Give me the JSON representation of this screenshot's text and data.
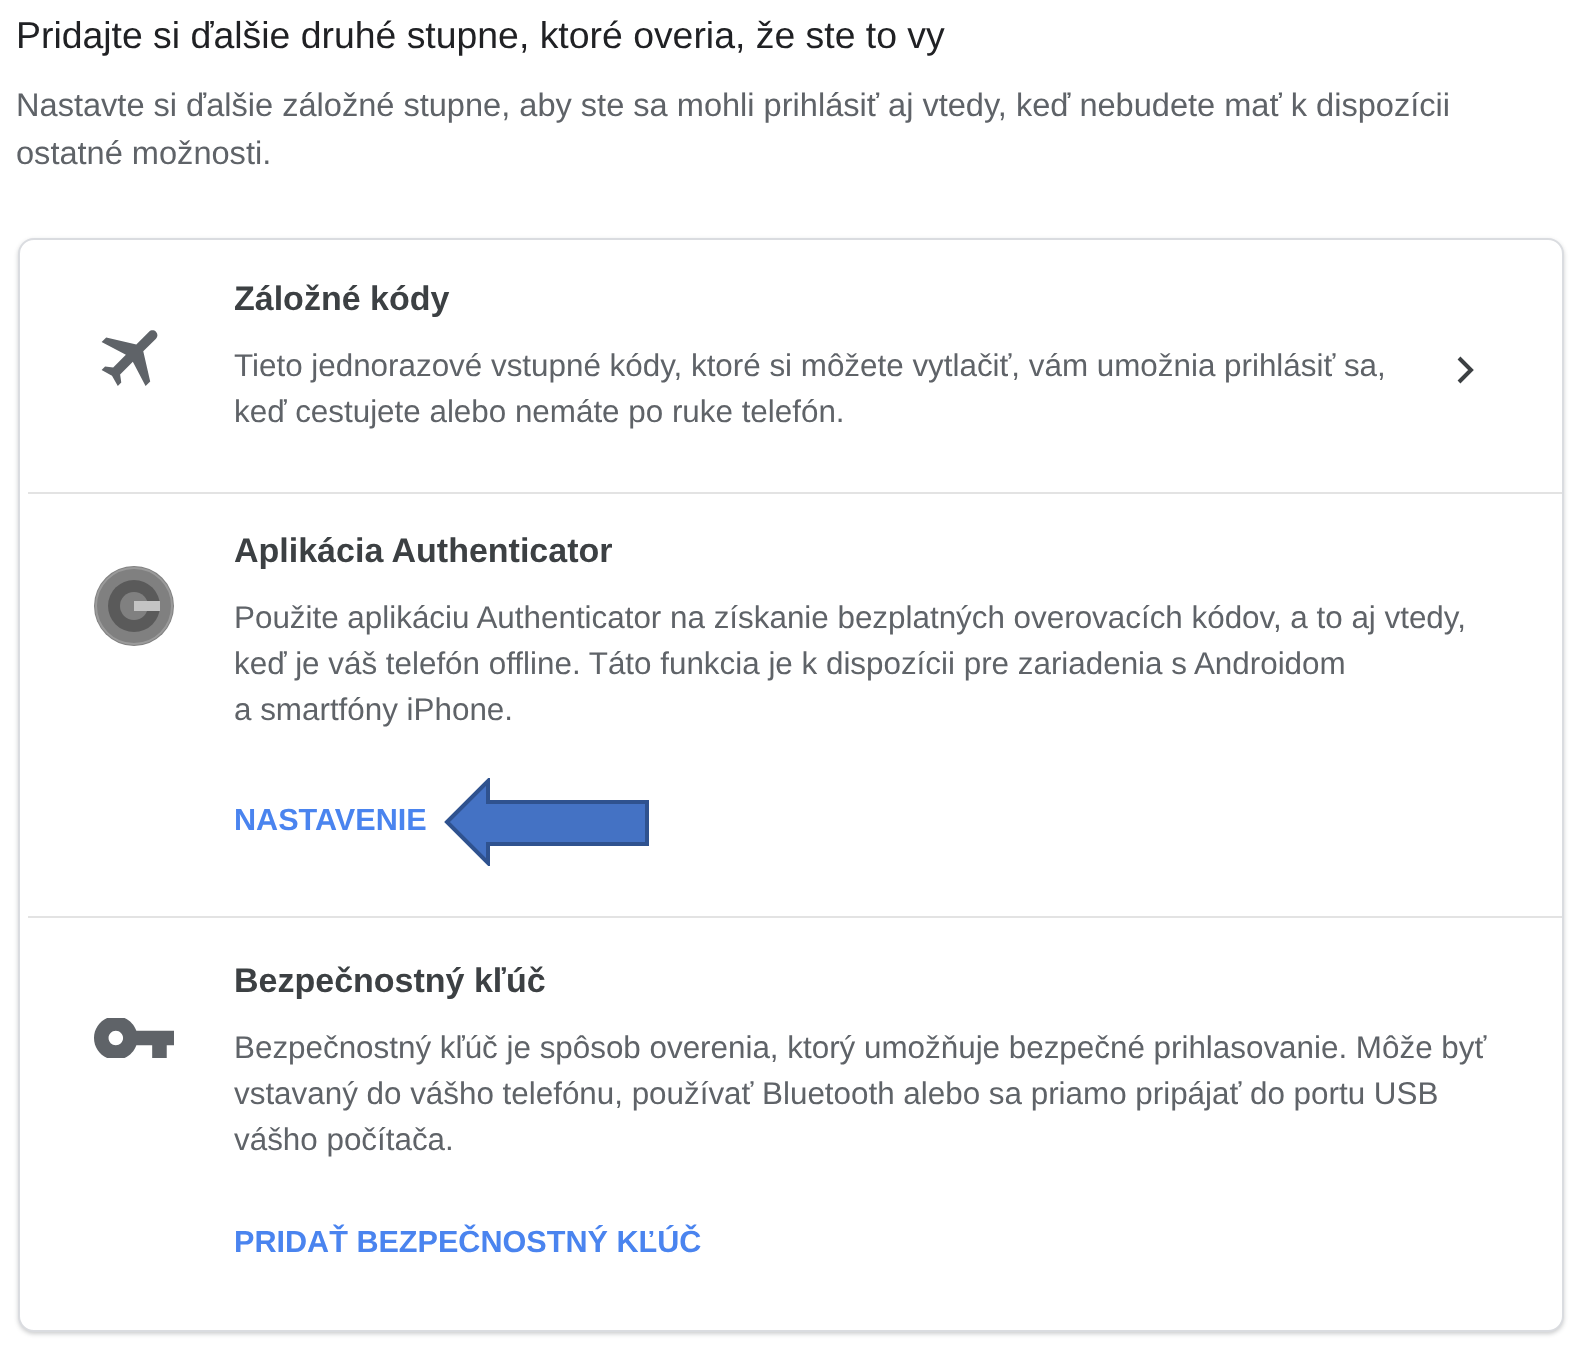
{
  "heading": "Pridajte si ďalšie druhé stupne, ktoré overia, že ste to vy",
  "subtitle": "Nastavte si ďalšie záložné stupne, aby ste sa mohli prihlásiť aj vtedy, keď nebudete mať k dispozícii ostatné možnosti.",
  "options": [
    {
      "kind": "backup_codes",
      "title": "Záložné kódy",
      "description": "Tieto jednorazové vstupné kódy, ktoré si môžete vytlačiť, vám umožnia prihlásiť sa, keď cestujete alebo nemáte po ruke telefón.",
      "highlighted": false
    },
    {
      "kind": "authenticator",
      "title": "Aplikácia Authenticator",
      "description": "Použite aplikáciu Authenticator na získanie bezplatných overovacích kódov, a to aj vtedy, keď je váš telefón offline. Táto funkcia je k dispozícii pre zariadenia s Androidom a smartfóny iPhone.",
      "action": "NASTAVENIE",
      "highlighted": true
    },
    {
      "kind": "security_key",
      "title": "Bezpečnostný kľúč",
      "description": "Bezpečnostný kľúč je spôsob overenia, ktorý umožňuje bezpečné prihlasovanie. Môže byť vstavaný do vášho telefónu, používať Bluetooth alebo sa priamo pripájať do portu USB vášho počítača.",
      "action": "PRIDAŤ BEZPEČNOSTNÝ KĽÚČ",
      "highlighted": false
    }
  ]
}
